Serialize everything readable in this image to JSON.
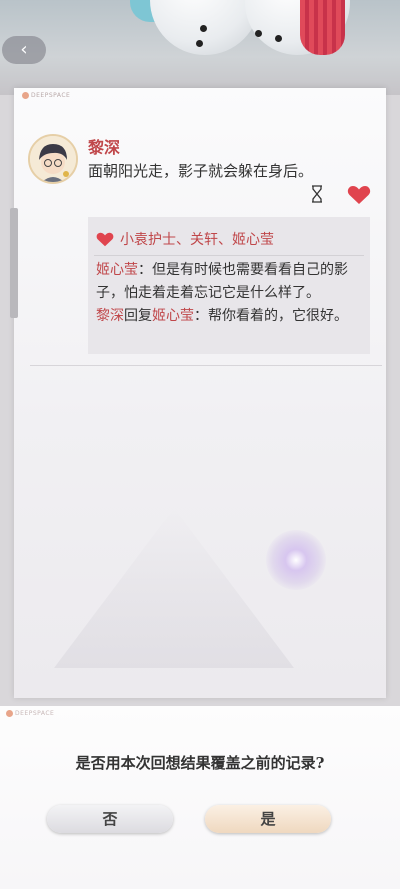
{
  "header": {
    "back_icon": "back-arrow-icon"
  },
  "card": {
    "logo_text": "DEEPSPACE",
    "post": {
      "author": "黎深",
      "text": "面朝阳光走，影子就会躲在身后。",
      "icons": [
        "hourglass-icon",
        "heart-icon"
      ]
    },
    "likes": "小袁护士、关轩、姬心莹",
    "comments": [
      {
        "from": "姬心莹",
        "reply_word": "",
        "to": "",
        "separator": "：",
        "text": "但是有时候也需要看看自己的影子，怕走着走着忘记它是什么样了。"
      },
      {
        "from": "黎深",
        "reply_word": "回复",
        "to": "姬心莹",
        "separator": "：",
        "text": "帮你看着的，它很好。"
      }
    ]
  },
  "dialog": {
    "logo_text": "DEEPSPACE",
    "question": "是否用本次回想结果覆盖之前的记录?",
    "no_label": "否",
    "yes_label": "是"
  },
  "colors": {
    "accent_red": "#c0474a",
    "heart": "#e0444e"
  }
}
